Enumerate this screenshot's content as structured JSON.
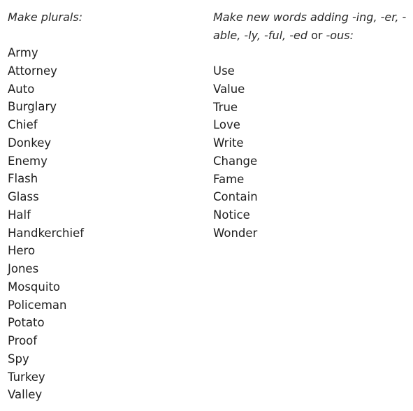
{
  "left_column": {
    "heading": "Make plurals:",
    "words": [
      "Army",
      "Attorney",
      "Auto",
      "Burglary",
      "Chief",
      "Donkey",
      "Enemy",
      "Flash",
      "Glass",
      "Half",
      "Handkerchief",
      "Hero",
      "Jones",
      "Mosquito",
      "Policeman",
      "Potato",
      "Proof",
      "Spy",
      "Turkey",
      "Valley"
    ]
  },
  "right_column": {
    "heading_line1": "Make new words adding -ing, -er, -",
    "heading_line2_italic": "able, -ly, -ful, -ed",
    "heading_line2_plain": " or ",
    "heading_line2_end": "-ous:",
    "words": [
      "Use",
      "Value",
      "True",
      "Love",
      "Write",
      "Change",
      "Fame",
      "Contain",
      "Notice",
      "Wonder"
    ]
  }
}
